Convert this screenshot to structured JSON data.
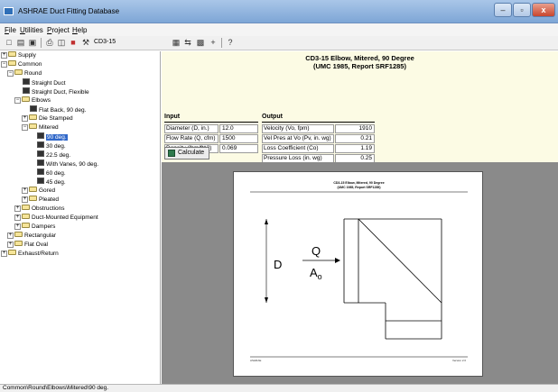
{
  "window": {
    "title": "ASHRAE Duct Fitting Database",
    "controls": [
      "–",
      "▫",
      "x"
    ]
  },
  "menu": [
    {
      "label": "File",
      "key": "F",
      "rest": "ile"
    },
    {
      "label": "Utilities",
      "key": "U",
      "rest": "tilities"
    },
    {
      "label": "Project",
      "key": "P",
      "rest": "roject"
    },
    {
      "label": "Help",
      "key": "H",
      "rest": "elp"
    }
  ],
  "toolbar": {
    "fitting_code": "CD3-15"
  },
  "tree": {
    "supply": "Supply",
    "common": "Common",
    "round": "Round",
    "straight_duct": "Straight Duct",
    "straight_duct_flexible": "Straight Duct, Flexible",
    "elbows": "Elbows",
    "flat_back": "Flat Back, 90 deg.",
    "die_stamped": "Die Stamped",
    "mitered": "Mitered",
    "deg90": "90 deg.",
    "deg30": "30 deg.",
    "deg22": "22.5 deg.",
    "vanes": "With Vanes, 90 deg.",
    "deg60": "60 deg.",
    "deg45": "45 deg.",
    "gored": "Gored",
    "pleated": "Pleated",
    "obstructions": "Obstructions",
    "duct_mounted": "Duct-Mounted Equipment",
    "dampers": "Dampers",
    "rectangular": "Rectangular",
    "flat_oval": "Flat Oval",
    "exhaust": "Exhaust/Return"
  },
  "fitting": {
    "title_line1": "CD3-15  Elbow, Mitered, 90 Degree",
    "title_line2": "(UMC 1985, Report SRF1285)"
  },
  "input": {
    "heading": "Input",
    "rows": [
      {
        "label": "Diameter (D, in.)",
        "value": "12.0"
      },
      {
        "label": "Flow Rate (Q, cfm)",
        "value": "1500"
      },
      {
        "label": "Density (lbm/ft^3)",
        "value": "0.069"
      }
    ]
  },
  "output": {
    "heading": "Output",
    "rows": [
      {
        "label": "Velocity (Vo, fpm)",
        "value": "1910"
      },
      {
        "label": "Vel Pres at Vo (Pv, in. wg)",
        "value": "0.21"
      },
      {
        "label": "Loss Coefficient (Co)",
        "value": "1.19"
      },
      {
        "label": "Pressure Loss (in. wg)",
        "value": "0.25"
      }
    ]
  },
  "calculate": {
    "label": "Calculate"
  },
  "diagram": {
    "title_line1": "CD3-15  Elbow, Mitered, 90 Degree",
    "title_line2": "(UMC 1985, Report SRF1285)",
    "label_d": "D",
    "label_q": "Q",
    "label_a": "A",
    "label_sub": "o",
    "footer_left": "ASHRAE",
    "footer_right": "Version 2.0"
  },
  "status": {
    "path": "Common\\Round\\Elbows\\Mitered\\90 deg."
  }
}
